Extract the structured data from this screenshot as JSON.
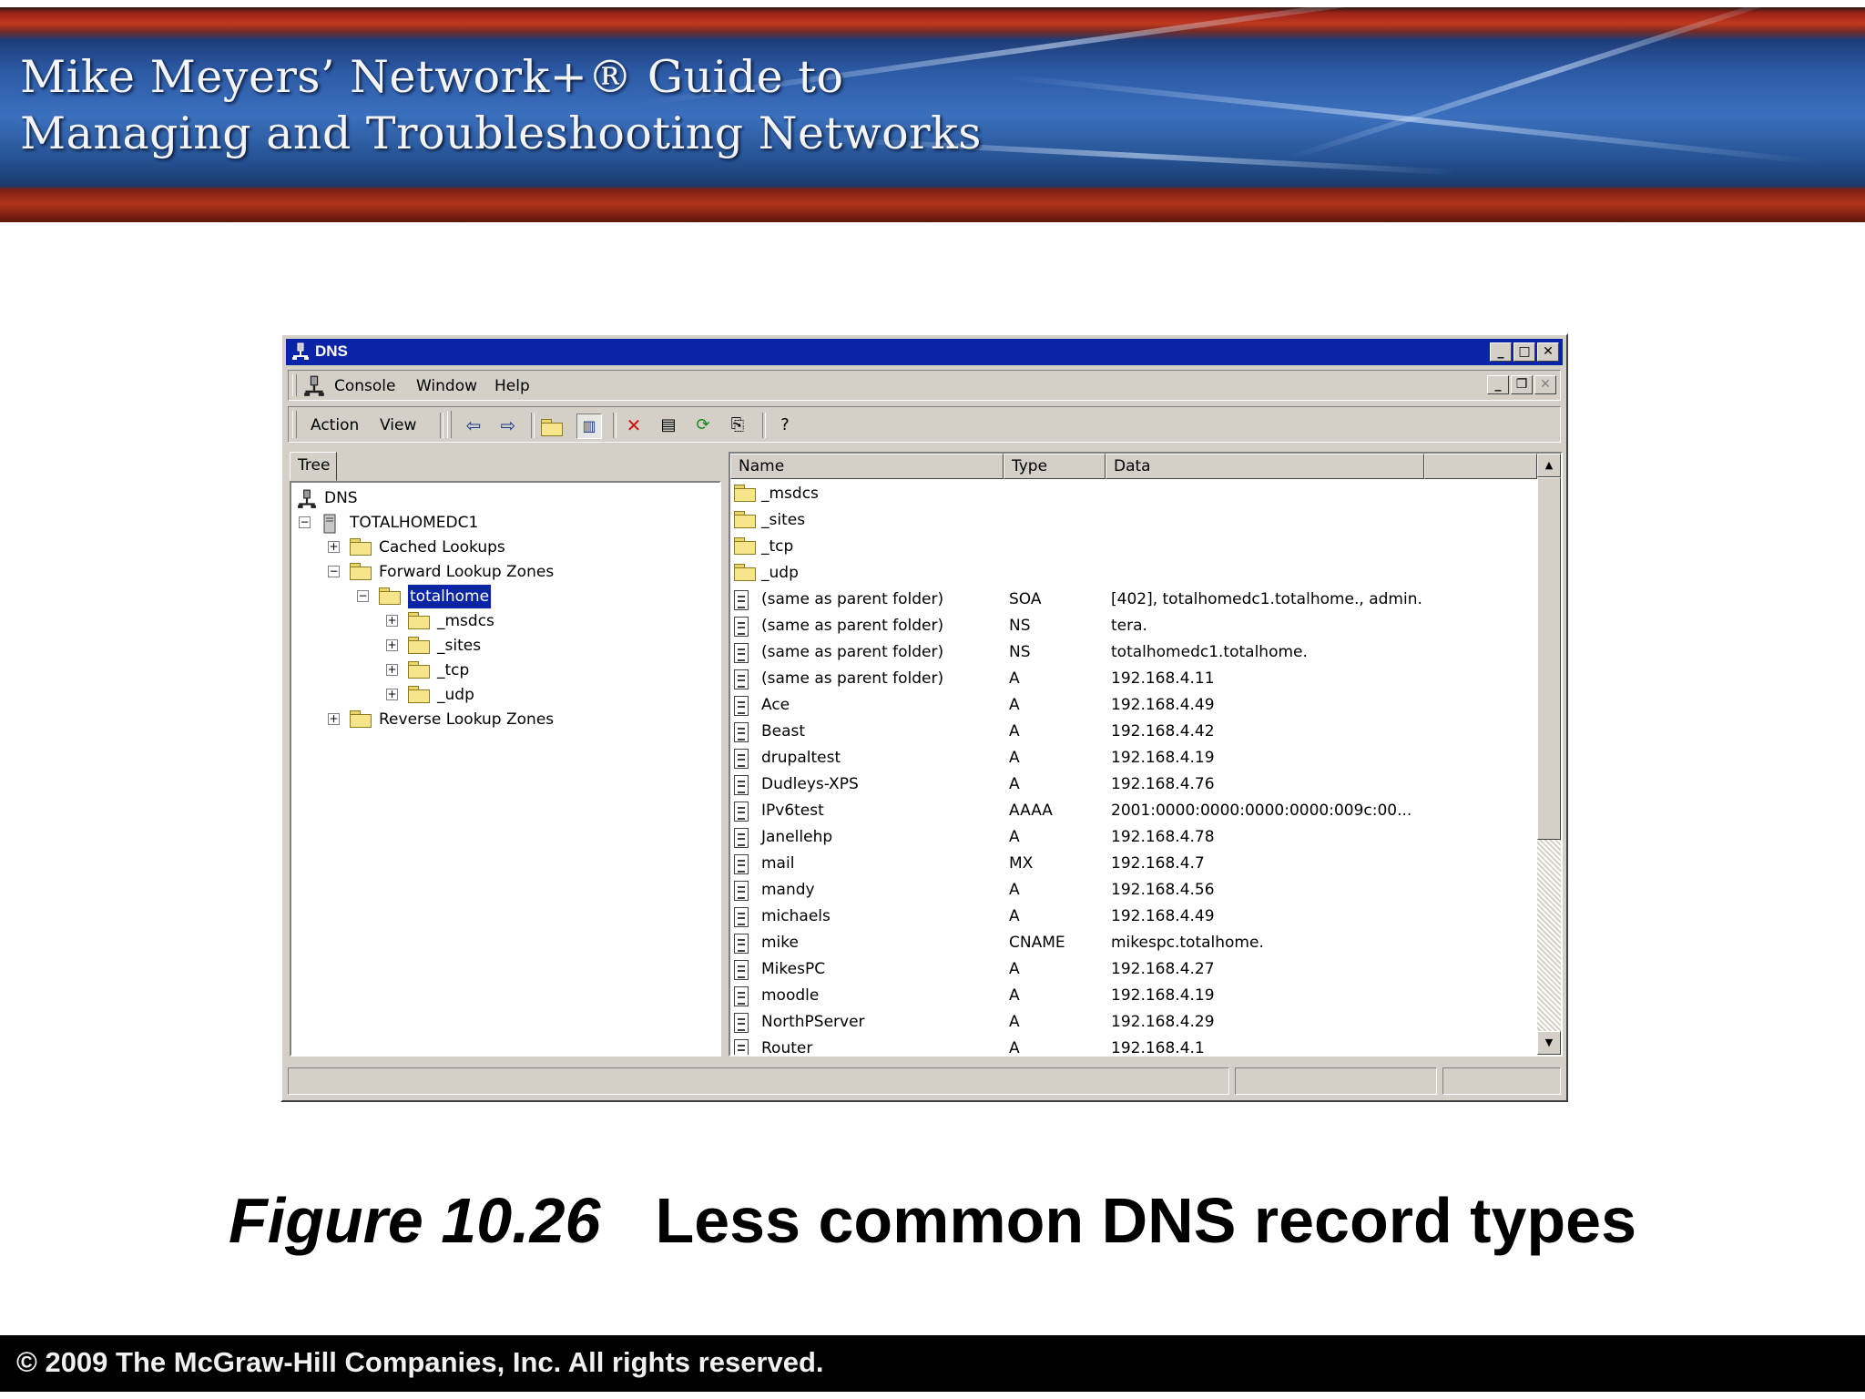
{
  "slide": {
    "banner_line1": "Mike Meyers’ Network+® Guide to",
    "banner_line2": "Managing and Troubleshooting Networks",
    "caption_figure": "Figure 10.26",
    "caption_text": "Less common DNS record types",
    "footer": "© 2009 The McGraw-Hill Companies, Inc. All rights reserved."
  },
  "window": {
    "title": "DNS",
    "menu": [
      "Console",
      "Window",
      "Help"
    ],
    "action_menu": [
      "Action",
      "View"
    ],
    "tree_tab": "Tree"
  },
  "tree": [
    {
      "label": "DNS",
      "icon": "dns-server-icon"
    },
    {
      "label": "TOTALHOMEDC1",
      "icon": "server-icon"
    },
    {
      "label": "Cached Lookups",
      "icon": "folder-icon"
    },
    {
      "label": "Forward Lookup Zones",
      "icon": "folder-icon"
    },
    {
      "label": "totalhome",
      "icon": "zone-icon",
      "selected": true
    },
    {
      "label": "_msdcs",
      "icon": "folder-icon"
    },
    {
      "label": "_sites",
      "icon": "folder-icon"
    },
    {
      "label": "_tcp",
      "icon": "folder-icon"
    },
    {
      "label": "_udp",
      "icon": "folder-icon"
    },
    {
      "label": "Reverse Lookup Zones",
      "icon": "folder-icon"
    }
  ],
  "list": {
    "columns": [
      "Name",
      "Type",
      "Data"
    ],
    "rows": [
      {
        "name": "_msdcs",
        "type": "",
        "data": "",
        "icon": "folder-icon"
      },
      {
        "name": "_sites",
        "type": "",
        "data": "",
        "icon": "folder-icon"
      },
      {
        "name": "_tcp",
        "type": "",
        "data": "",
        "icon": "folder-icon"
      },
      {
        "name": "_udp",
        "type": "",
        "data": "",
        "icon": "folder-icon"
      },
      {
        "name": "(same as parent folder)",
        "type": "SOA",
        "data": "[402], totalhomedc1.totalhome., admin.",
        "icon": "record-icon"
      },
      {
        "name": "(same as parent folder)",
        "type": "NS",
        "data": "tera.",
        "icon": "record-icon"
      },
      {
        "name": "(same as parent folder)",
        "type": "NS",
        "data": "totalhomedc1.totalhome.",
        "icon": "record-icon"
      },
      {
        "name": "(same as parent folder)",
        "type": "A",
        "data": "192.168.4.11",
        "icon": "record-icon"
      },
      {
        "name": "Ace",
        "type": "A",
        "data": "192.168.4.49",
        "icon": "record-icon"
      },
      {
        "name": "Beast",
        "type": "A",
        "data": "192.168.4.42",
        "icon": "record-icon"
      },
      {
        "name": "drupaltest",
        "type": "A",
        "data": "192.168.4.19",
        "icon": "record-icon"
      },
      {
        "name": "Dudleys-XPS",
        "type": "A",
        "data": "192.168.4.76",
        "icon": "record-icon"
      },
      {
        "name": "IPv6test",
        "type": "AAAA",
        "data": "2001:0000:0000:0000:0000:009c:00...",
        "icon": "record-icon"
      },
      {
        "name": "Janellehp",
        "type": "A",
        "data": "192.168.4.78",
        "icon": "record-icon"
      },
      {
        "name": "mail",
        "type": "MX",
        "data": "192.168.4.7",
        "icon": "record-icon"
      },
      {
        "name": "mandy",
        "type": "A",
        "data": "192.168.4.56",
        "icon": "record-icon"
      },
      {
        "name": "michaels",
        "type": "A",
        "data": "192.168.4.49",
        "icon": "record-icon"
      },
      {
        "name": "mike",
        "type": "CNAME",
        "data": "mikespc.totalhome.",
        "icon": "record-icon"
      },
      {
        "name": "MikesPC",
        "type": "A",
        "data": "192.168.4.27",
        "icon": "record-icon"
      },
      {
        "name": "moodle",
        "type": "A",
        "data": "192.168.4.19",
        "icon": "record-icon"
      },
      {
        "name": "NorthPServer",
        "type": "A",
        "data": "192.168.4.29",
        "icon": "record-icon"
      },
      {
        "name": "Router",
        "type": "A",
        "data": "192.168.4.1",
        "icon": "record-icon"
      }
    ]
  },
  "colors": {
    "titlebar": "#0a24a8",
    "chrome": "#d4d0c8",
    "selection": "#0a24a8"
  }
}
